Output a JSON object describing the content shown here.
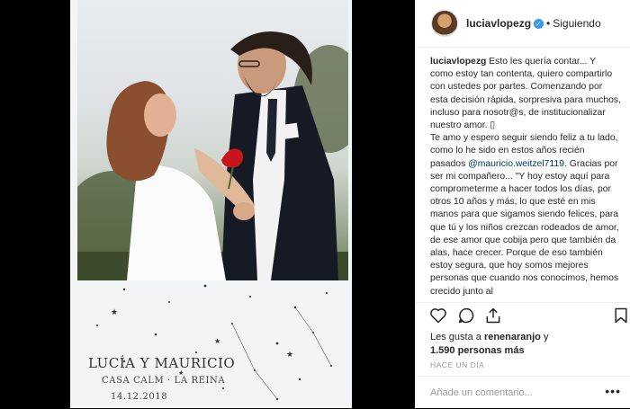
{
  "post": {
    "card_names": "LUCÍA Y MAURICIO",
    "card_venue": "CASA CALM · LA REINA",
    "card_date": "14.12.2018"
  },
  "header": {
    "username": "luciavlopezg",
    "separator": "•",
    "follow_label": "Siguiendo"
  },
  "caption": {
    "username": "luciavlopezg",
    "part1": " Esto les quería contar... Y como estoy tan contenta, quiero compartirlo con ustedes por partes. Comenzando por esta decisión rápida, sorpresiva para muchos, incluso para nosotr@s, de institucionalizar nuestro amor. ▯",
    "part2": "Te amo y espero seguir siendo feliz a tu lado, como lo he sido en estos años recién pasados ",
    "mention": "@mauricio.weitzel7119",
    "part3": ". Gracias por ser mi compañero... \"Y hoy estoy aquí para comprometerme a hacer todos los días, por otros 10 años y más, lo que esté en mis manos para que sigamos siendo felices, para que tú y los niños crezcan rodeados de amor, de ese amor que cobija pero que también da alas, hace crecer. Porque de eso también estoy segura, que hoy somos mejores personas que cuando nos conocimos, hemos crecido junto al"
  },
  "likes": {
    "prefix": "Les gusta a ",
    "user": "renenaranjo",
    "middle": " y",
    "count": "1.590 personas más"
  },
  "timestamp": "HACE UN DÍA",
  "comment": {
    "placeholder": "Añade un comentario...",
    "more": "•••"
  }
}
